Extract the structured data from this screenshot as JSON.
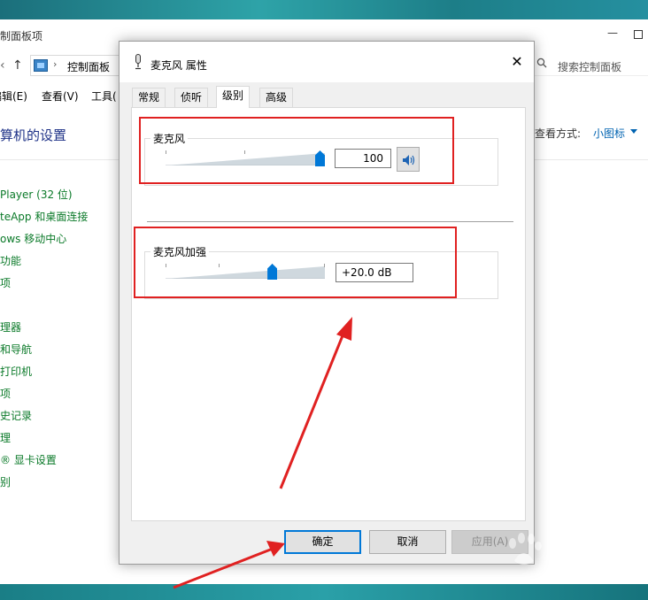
{
  "control_panel": {
    "title": "制面板项",
    "address": "控制面板",
    "search_placeholder": "搜索控制面板",
    "menu": [
      "编辑(E)",
      "查看(V)",
      "工具("
    ],
    "heading": "算机的设置",
    "view_label": "查看方式:",
    "view_value": "小图标",
    "links": [
      "Player (32 位)",
      "teApp 和桌面连接",
      "ows 移动中心",
      "功能",
      "项",
      "理器",
      "和导航",
      "打印机",
      "项",
      "史记录",
      "理",
      "® 显卡设置",
      "别"
    ]
  },
  "dialog": {
    "title": "麦克风 属性",
    "tabs": [
      "常规",
      "侦听",
      "级别",
      "高级"
    ],
    "active_tab": "级别",
    "microphone": {
      "label": "麦克风",
      "value_text": "100",
      "level": 1.0
    },
    "boost": {
      "label": "麦克风加强",
      "value_text": "+20.0 dB",
      "level": 0.67
    },
    "buttons": {
      "ok": "确定",
      "cancel": "取消",
      "apply": "应用(A)"
    }
  },
  "watermark": {
    "text": "Bai 经验",
    "sub": "jingyan.baidu.com"
  },
  "colors": {
    "accent": "#0078d7",
    "annotation": "#e02121",
    "link": "#0b7a29"
  }
}
